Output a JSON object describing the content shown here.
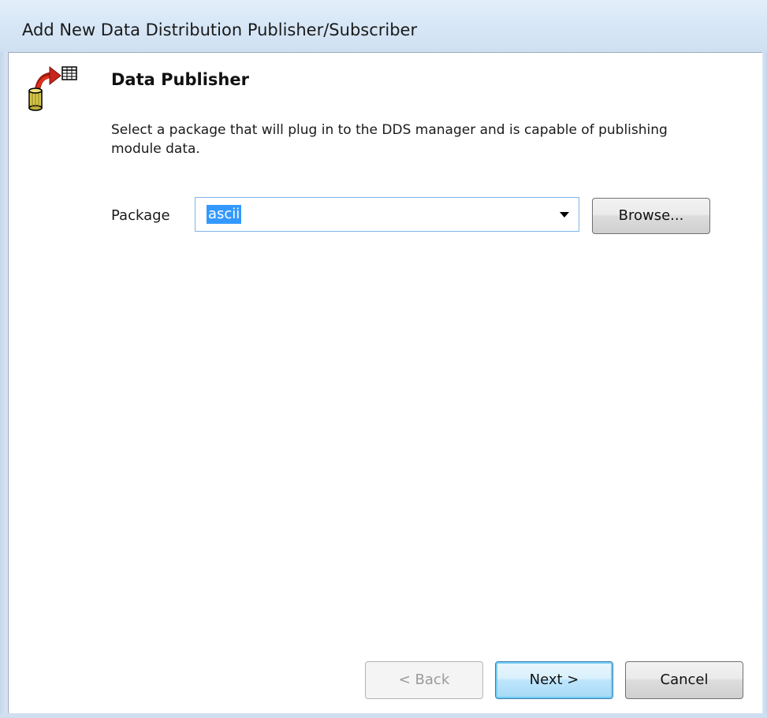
{
  "window": {
    "title": "Add New Data Distribution Publisher/Subscriber"
  },
  "page": {
    "icon": "database-publish-icon",
    "heading": "Data Publisher",
    "description": "Select a package that will plug in to the DDS manager and is capable of publishing module data."
  },
  "form": {
    "package_label": "Package",
    "package_value": "ascii",
    "browse_label": "Browse..."
  },
  "buttons": {
    "back_label": "< Back",
    "next_label": "Next >",
    "cancel_label": "Cancel"
  },
  "colors": {
    "selection": "#3399ff",
    "focus_border": "#7eb4ea",
    "titlebar": "#d9e8f7"
  }
}
